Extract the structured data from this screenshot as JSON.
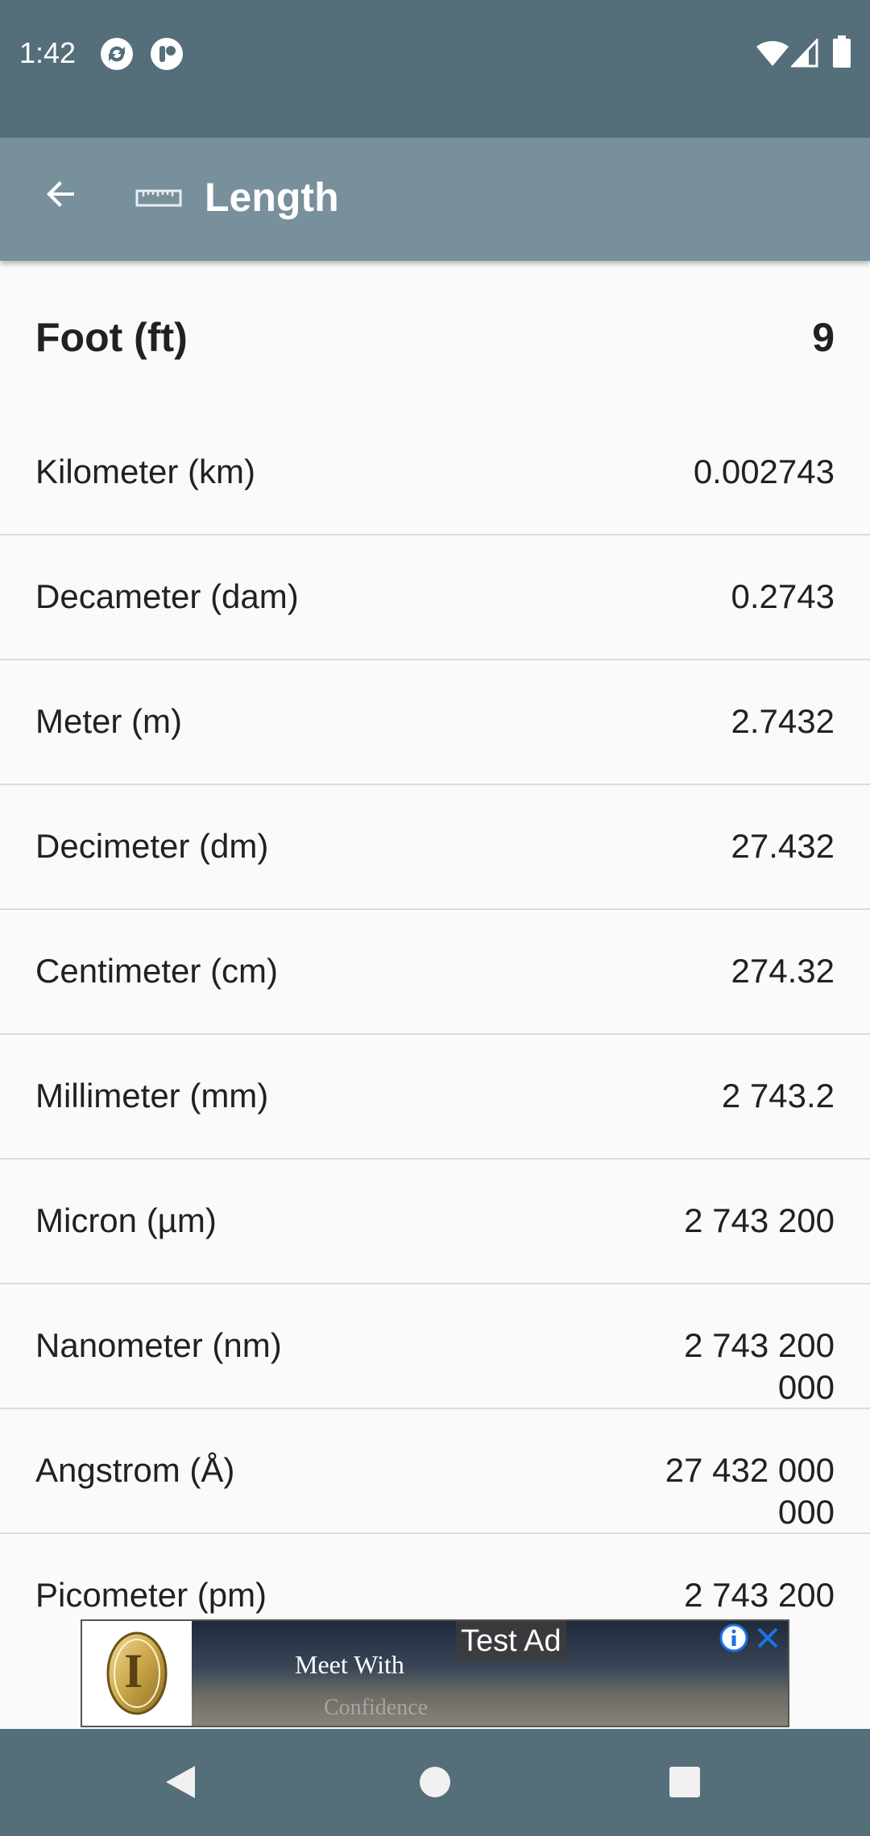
{
  "status_bar": {
    "time": "1:42",
    "icons": [
      "sync-icon",
      "app-notification-icon",
      "wifi-icon",
      "signal-icon",
      "battery-icon"
    ]
  },
  "app_bar": {
    "title": "Length",
    "back_icon": "arrow-back-icon",
    "category_icon": "ruler-icon"
  },
  "primary_unit": {
    "name": "Foot (ft)",
    "value": "9"
  },
  "conversions": [
    {
      "name": "Kilometer (km)",
      "value": "0.002743"
    },
    {
      "name": "Decameter (dam)",
      "value": "0.2743"
    },
    {
      "name": "Meter (m)",
      "value": "2.7432"
    },
    {
      "name": "Decimeter (dm)",
      "value": "27.432"
    },
    {
      "name": "Centimeter (cm)",
      "value": "274.32"
    },
    {
      "name": "Millimeter (mm)",
      "value": "2 743.2"
    },
    {
      "name": "Micron (µm)",
      "value": "2 743 200"
    },
    {
      "name": "Nanometer (nm)",
      "value": "2 743 200 000"
    },
    {
      "name": "Angstrom (Å)",
      "value": "27 432 000 000"
    },
    {
      "name": "Picometer (pm)",
      "value": "2 743 200"
    }
  ],
  "ad": {
    "label": "Test Ad",
    "headline": "Meet With",
    "subline": "Confidence",
    "logo_letter": "I"
  },
  "colors": {
    "status_bar": "#546e7a",
    "app_bar": "#78909c",
    "background": "#fafafa",
    "divider": "#dcdcdc",
    "text": "#212121"
  }
}
